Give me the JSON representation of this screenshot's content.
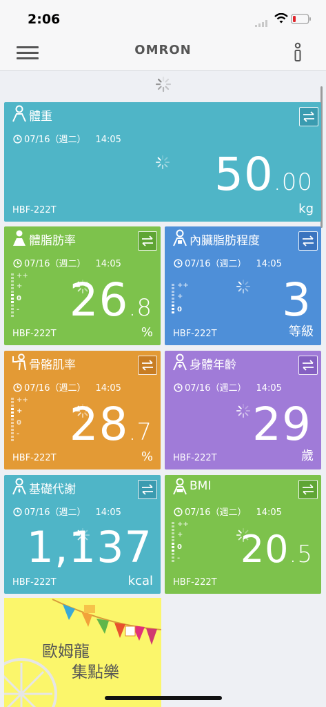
{
  "status_bar": {
    "time": "2:06"
  },
  "nav": {
    "brand": "OMRON"
  },
  "colors": {
    "teal": "#4fb5c7",
    "green": "#7dc24c",
    "blue": "#4e8fd8",
    "orange": "#e39a35",
    "purple": "#a07bd8",
    "promo_yellow": "#fbf66b"
  },
  "cards": [
    {
      "title": "體重",
      "icon": "person-icon",
      "date": "07/16（週二）",
      "time": "14:05",
      "int": "50",
      "dec": "00",
      "unit": "kg",
      "model": "HBF-222T"
    },
    {
      "title": "體脂肪率",
      "icon": "body-fat-icon",
      "date": "07/16（週二）",
      "time": "14:05",
      "int": "26",
      "dec": "8",
      "unit": "%",
      "model": "HBF-222T",
      "gauge": [
        "++",
        "+",
        "0",
        "-"
      ],
      "gauge_active": "0"
    },
    {
      "title": "內臟脂肪程度",
      "icon": "visceral-fat-icon",
      "date": "07/16（週二）",
      "time": "14:05",
      "int": "3",
      "dec": "",
      "unit": "等級",
      "model": "HBF-222T",
      "gauge": [
        "++",
        "+",
        "0"
      ],
      "gauge_active": "0"
    },
    {
      "title": "骨骼肌率",
      "icon": "muscle-icon",
      "date": "07/16（週二）",
      "time": "14:05",
      "int": "28",
      "dec": "7",
      "unit": "%",
      "model": "HBF-222T",
      "gauge": [
        "++",
        "+",
        "0",
        "-"
      ],
      "gauge_active": "+"
    },
    {
      "title": "身體年齡",
      "icon": "body-age-icon",
      "date": "07/16（週二）",
      "time": "14:05",
      "int": "29",
      "dec": "",
      "unit": "歲",
      "model": "HBF-222T"
    },
    {
      "title": "基礎代謝",
      "icon": "metabolism-icon",
      "date": "07/16（週二）",
      "time": "14:05",
      "int": "1,137",
      "dec": "",
      "unit": "kcal",
      "model": "HBF-222T"
    },
    {
      "title": "BMI",
      "icon": "bmi-icon",
      "date": "07/16（週二）",
      "time": "14:05",
      "int": "20",
      "dec": "5",
      "unit": "",
      "model": "HBF-222T",
      "gauge": [
        "++",
        "+",
        "0",
        "-"
      ],
      "gauge_active": "0"
    }
  ],
  "promo": {
    "line1": "歐姆龍",
    "line2": "集點樂"
  }
}
